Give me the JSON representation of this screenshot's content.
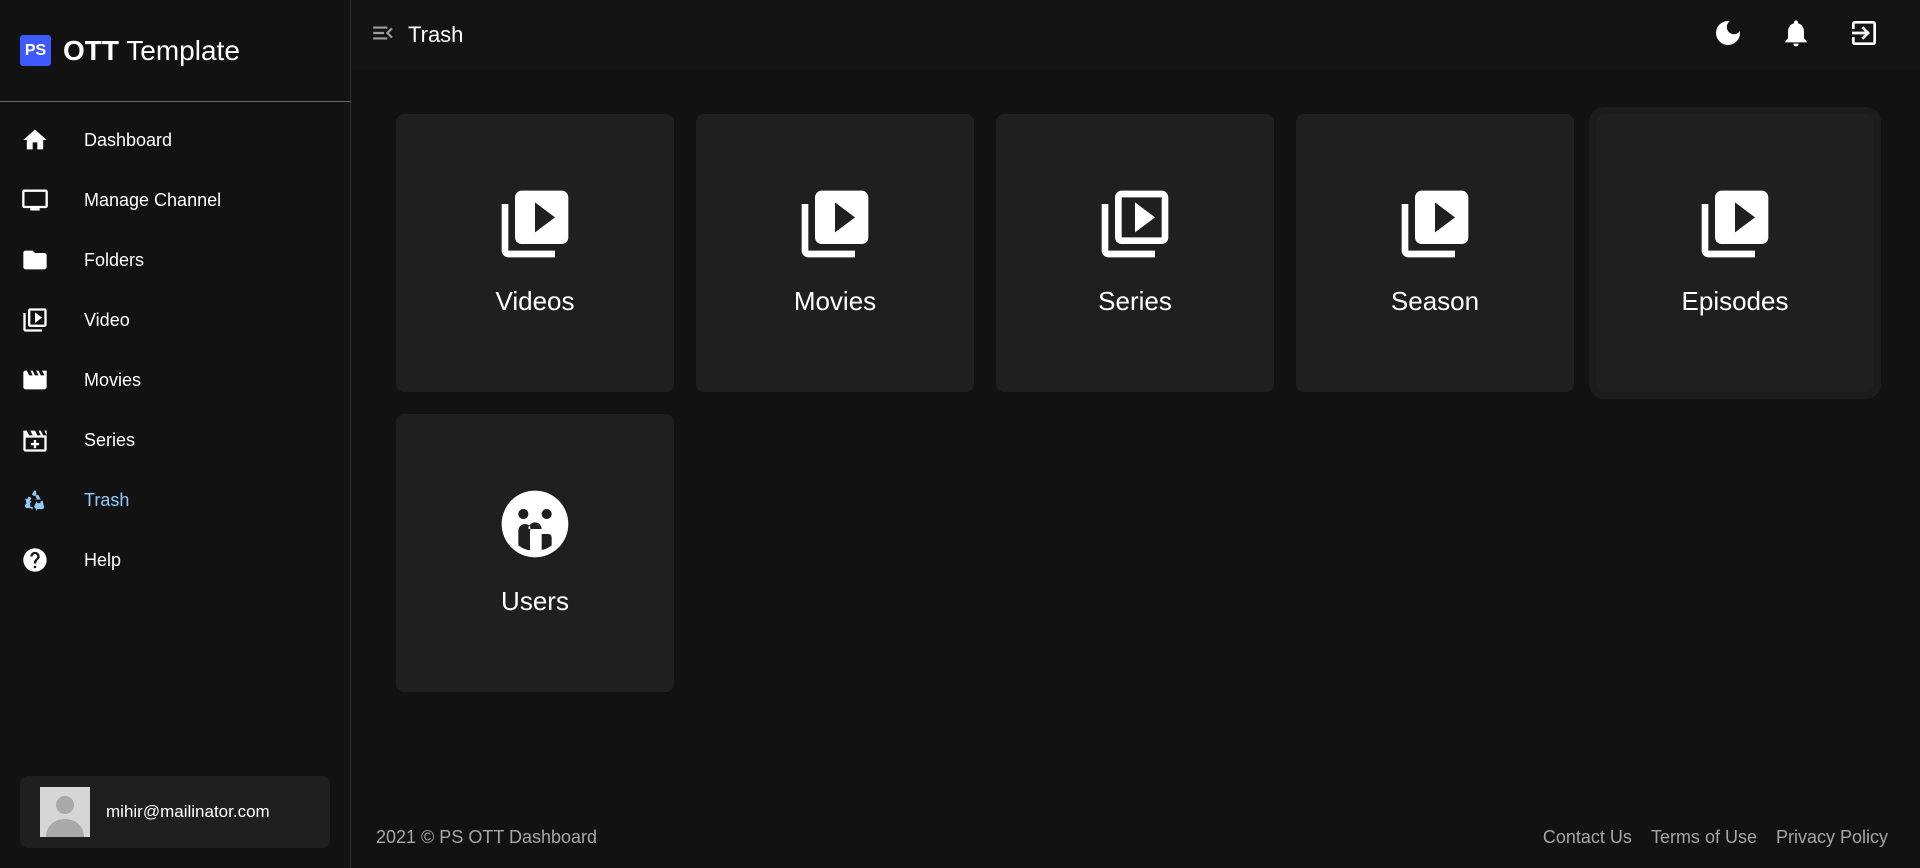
{
  "brand": {
    "logo": "PS",
    "title_bold": "OTT",
    "title_rest": " Template",
    "logo_color": "#3d5afe"
  },
  "sidebar": {
    "items": [
      {
        "label": "Dashboard",
        "icon": "home-icon"
      },
      {
        "label": "Manage Channel",
        "icon": "monitor-icon"
      },
      {
        "label": "Folders",
        "icon": "folder-icon"
      },
      {
        "label": "Video",
        "icon": "video-library-icon"
      },
      {
        "label": "Movies",
        "icon": "movie-clapper-icon"
      },
      {
        "label": "Series",
        "icon": "series-clapper-icon"
      },
      {
        "label": "Trash",
        "icon": "recycle-icon",
        "active": true
      },
      {
        "label": "Help",
        "icon": "help-circle-icon"
      }
    ],
    "active_color": "#90caf9"
  },
  "user": {
    "email": "mihir@mailinator.com"
  },
  "topbar": {
    "title": "Trash",
    "actions": [
      "moon-icon",
      "bell-icon",
      "logout-icon"
    ]
  },
  "tiles": [
    {
      "label": "Videos",
      "icon": "video-library-icon"
    },
    {
      "label": "Movies",
      "icon": "video-library-icon"
    },
    {
      "label": "Series",
      "icon": "video-library-outline-icon"
    },
    {
      "label": "Season",
      "icon": "video-library-icon"
    },
    {
      "label": "Episodes",
      "icon": "video-library-icon"
    },
    {
      "label": "Users",
      "icon": "users-group-icon"
    }
  ],
  "footer": {
    "copyright": "2021 © PS OTT Dashboard",
    "links": [
      "Contact Us",
      "Terms of Use",
      "Privacy Policy"
    ]
  }
}
